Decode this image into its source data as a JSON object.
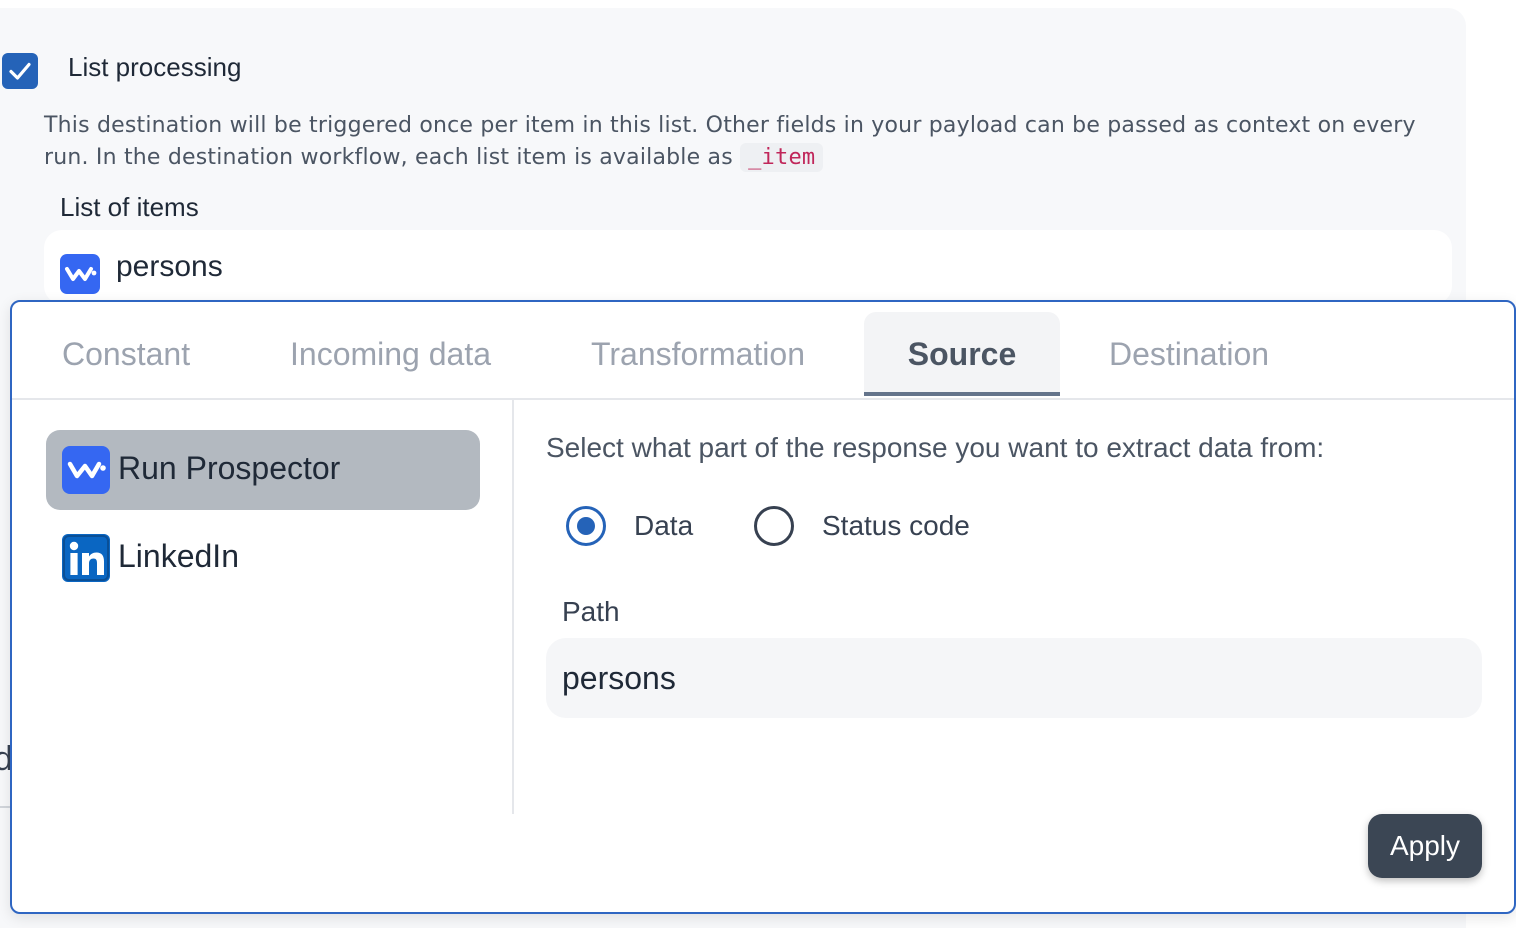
{
  "list_processing": {
    "checked": true,
    "label": "List processing",
    "description_prefix": "This destination will be triggered once per item in this list. Other fields in your payload can be passed as context on every run. In the destination workflow, each list item is available as",
    "item_token": "_item"
  },
  "list_of_items": {
    "label": "List of items",
    "value": "persons",
    "icon": "run-prospector-logo"
  },
  "edge_fragment": "d",
  "popup": {
    "tabs": [
      {
        "label": "Constant",
        "active": false
      },
      {
        "label": "Incoming data",
        "active": false
      },
      {
        "label": "Transformation",
        "active": false
      },
      {
        "label": "Source",
        "active": true
      },
      {
        "label": "Destination",
        "active": false
      }
    ],
    "sources": [
      {
        "label": "Run Prospector",
        "icon": "run-prospector-logo",
        "selected": true
      },
      {
        "label": "LinkedIn",
        "icon": "linkedin-logo",
        "selected": false
      }
    ],
    "prompt": "Select what part of the response you want to extract data from:",
    "radio_options": [
      {
        "label": "Data",
        "checked": true
      },
      {
        "label": "Status code",
        "checked": false
      }
    ],
    "path": {
      "label": "Path",
      "value": "persons"
    },
    "apply_label": "Apply"
  },
  "colors": {
    "accent_blue": "#2563b8",
    "popup_border": "#2f66c2",
    "apply_button": "#3b4654",
    "selected_source_bg": "#b3b9c0",
    "code_text": "#c0265a",
    "linkedin_blue": "#0a66c2",
    "prospector_blue": "#3567f2"
  }
}
